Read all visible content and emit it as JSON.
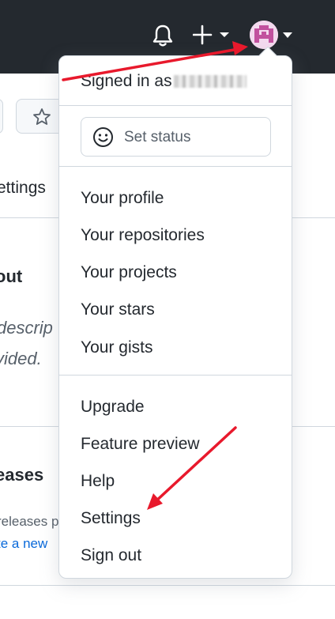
{
  "header": {
    "notifications_icon": "bell-icon",
    "create_icon": "plus-icon",
    "avatar_icon": "identicon-avatar"
  },
  "background_page": {
    "settings_tab": "ettings",
    "about_heading": "out",
    "description_line1": "descrip",
    "description_line2": "vided.",
    "releases_heading": "eases",
    "releases_text": "releases p",
    "releases_link": "te a new"
  },
  "menu": {
    "signed_in_prefix": "Signed in as",
    "set_status_label": "Set status",
    "section1": [
      "Your profile",
      "Your repositories",
      "Your projects",
      "Your stars",
      "Your gists"
    ],
    "section2": [
      "Upgrade",
      "Feature preview",
      "Help",
      "Settings",
      "Sign out"
    ]
  },
  "colors": {
    "header_bg": "#24292f",
    "annotation_arrow": "#e8192c",
    "link": "#0969da"
  }
}
